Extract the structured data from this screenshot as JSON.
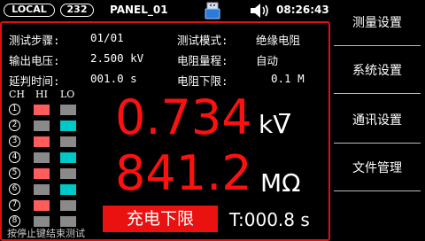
{
  "statusbar": {
    "mode_badge": "LOCAL",
    "port_badge": "232",
    "panel_title": "PANEL_01",
    "clock": "08:26:43"
  },
  "info": {
    "step_label": "测试步骤:",
    "step_value": "01/01",
    "mode_label": "测试模式:",
    "mode_value": "绝缘电阻",
    "voltage_label": "输出电压:",
    "voltage_value": "2.500 kV",
    "range_label": "电阻量程:",
    "range_value": "自动",
    "delay_label": "延判时间:",
    "delay_value": "001.0 s",
    "lower_label": "电阻下限:",
    "lower_value": "0.1 M"
  },
  "channels": {
    "headers": [
      "CH",
      "HI",
      "LO"
    ],
    "rows": [
      {
        "ch": "1",
        "hi": "red",
        "lo": "gray"
      },
      {
        "ch": "2",
        "hi": "gray",
        "lo": "cyan"
      },
      {
        "ch": "3",
        "hi": "red",
        "lo": "gray"
      },
      {
        "ch": "4",
        "hi": "gray",
        "lo": "cyan"
      },
      {
        "ch": "5",
        "hi": "red",
        "lo": "gray"
      },
      {
        "ch": "6",
        "hi": "gray",
        "lo": "cyan"
      },
      {
        "ch": "7",
        "hi": "red",
        "lo": "gray"
      },
      {
        "ch": "8",
        "hi": "gray",
        "lo": "gray"
      }
    ]
  },
  "measure": {
    "voltage": "0.734",
    "voltage_unit": "kV",
    "resistance": "841.2",
    "resistance_unit": "MΩ",
    "state": "充电下限",
    "timer": "T:000.8 s",
    "hint": "按停止键结束测试"
  },
  "menu": {
    "items": [
      "测量设置",
      "系统设置",
      "通讯设置",
      "文件管理"
    ]
  },
  "colors": {
    "accent_red": "#ea1111",
    "led_red": "#ff5c5c",
    "led_cyan": "#00c8c8",
    "led_gray": "#8a8a8a"
  }
}
